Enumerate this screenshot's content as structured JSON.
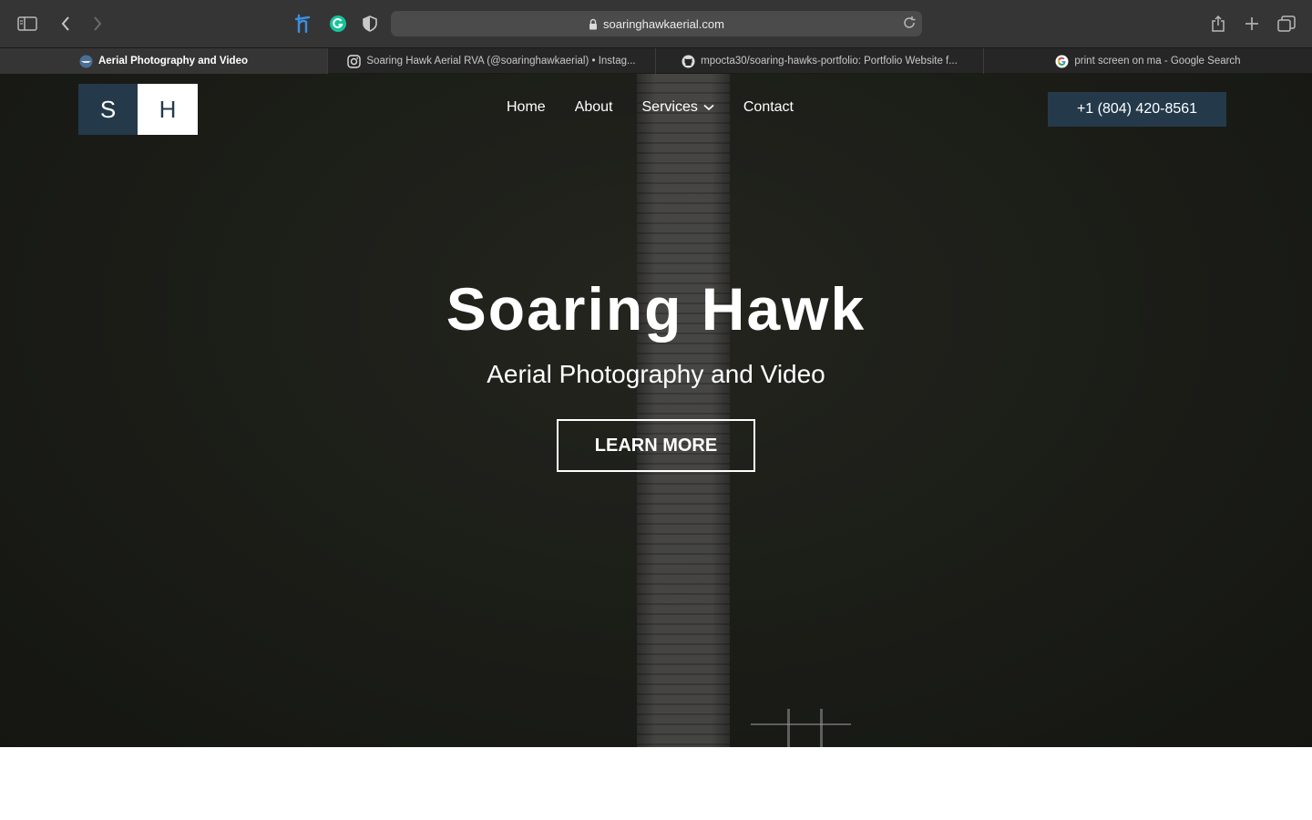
{
  "browser": {
    "url": "soaringhawkaerial.com",
    "tabs": [
      {
        "label": "Aerial Photography and Video",
        "active": true,
        "icon": "site-favicon"
      },
      {
        "label": "Soaring Hawk Aerial RVA (@soaringhawkaerial) • Instag...",
        "active": false,
        "icon": "instagram-icon"
      },
      {
        "label": "mpocta30/soaring-hawks-portfolio: Portfolio Website f...",
        "active": false,
        "icon": "github-icon"
      },
      {
        "label": "print screen on ma - Google Search",
        "active": false,
        "icon": "google-icon"
      }
    ]
  },
  "site": {
    "logo": {
      "left": "S",
      "right": "H"
    },
    "nav": [
      {
        "label": "Home"
      },
      {
        "label": "About"
      },
      {
        "label": "Services",
        "has_dropdown": true
      },
      {
        "label": "Contact"
      }
    ],
    "phone": "+1 (804) 420-8561",
    "hero": {
      "title": "Soaring Hawk",
      "subtitle": "Aerial Photography and Video",
      "cta": "LEARN MORE"
    }
  },
  "colors": {
    "brand": "#243a4b",
    "chrome": "#353535",
    "tabstrip": "#262626"
  }
}
